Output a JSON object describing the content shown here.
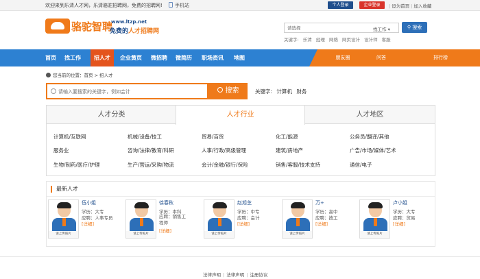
{
  "topbar": {
    "welcome": "欢迎来到乐清人才网，乐清骆驼招聘网，免费的招聘网!",
    "mobile": "手机站",
    "person_login": "个人登录",
    "company_login": "企业登录",
    "set_home": "设为首页",
    "add_fav": "加入收藏"
  },
  "header": {
    "logo_name": "骆驼智聘",
    "logo_url": "www.ltzp.net",
    "logo_slogan_a": "免费的",
    "logo_slogan_b": "人才招聘网",
    "search_placeholder": "请选择",
    "search_select": "找工作",
    "search_button": "搜索",
    "keywords_label": "关键字:",
    "keywords": [
      "乐清",
      "经理",
      "网络",
      "网页设计",
      "设计师",
      "客服"
    ]
  },
  "nav": {
    "items": [
      "首页",
      "找工作",
      "招人才",
      "企业黄页",
      "微招聘",
      "微简历",
      "职场资讯",
      "地图"
    ],
    "active_index": 2,
    "sub_items": [
      "朋友圈",
      "问答",
      "排行榜"
    ]
  },
  "breadcrumb": {
    "label": "您当前的位置：",
    "home": "首页",
    "sep": ">",
    "current": "招人才"
  },
  "main_search": {
    "placeholder": "请输入要搜索的关键字，例如会计",
    "button": "搜索",
    "keywords_label": "关键字:",
    "keywords": [
      "计算机",
      "财务"
    ]
  },
  "category": {
    "tabs": [
      "人才分类",
      "人才行业",
      "人才地区"
    ],
    "active_tab": 1,
    "rows": [
      [
        "计算机/互联网",
        "机械/设备/技工",
        "贸易/百货",
        "化工/能源",
        "公务员/翻译/其他"
      ],
      [
        "服务业",
        "咨询/法律/教育/科研",
        "人事/行政/高级管理",
        "建筑/房地产",
        "广告/市场/媒体/艺术"
      ],
      [
        "生物/制药/医疗/护理",
        "生产/营运/采购/物流",
        "会计/金融/银行/保险",
        "销售/客服/技术支持",
        "通信/电子"
      ]
    ]
  },
  "talents": {
    "title": "最新人才",
    "photo_caption": "请上传照片",
    "detail_label": "[详细]",
    "items": [
      {
        "name": "伍小姐",
        "edu": "学历：大专",
        "job": "应聘：人事专员"
      },
      {
        "name": "徐春秋",
        "edu": "学历：本科",
        "job": "应聘：销售工程师"
      },
      {
        "name": "赵旭芝",
        "edu": "学历：中专",
        "job": "应聘：会计"
      },
      {
        "name": "万+",
        "edu": "学历：高中",
        "job": "应聘：技工"
      },
      {
        "name": "卢小姐",
        "edu": "学历：大专",
        "job": "应聘：贸易"
      }
    ]
  },
  "footer": {
    "links": [
      "法律声明",
      "法律声明",
      "注册协议"
    ]
  },
  "colors": {
    "accent": "#ef7a1a",
    "nav_blue": "#2d81d2",
    "dark_blue": "#1f4e8c",
    "red": "#d9342b"
  }
}
